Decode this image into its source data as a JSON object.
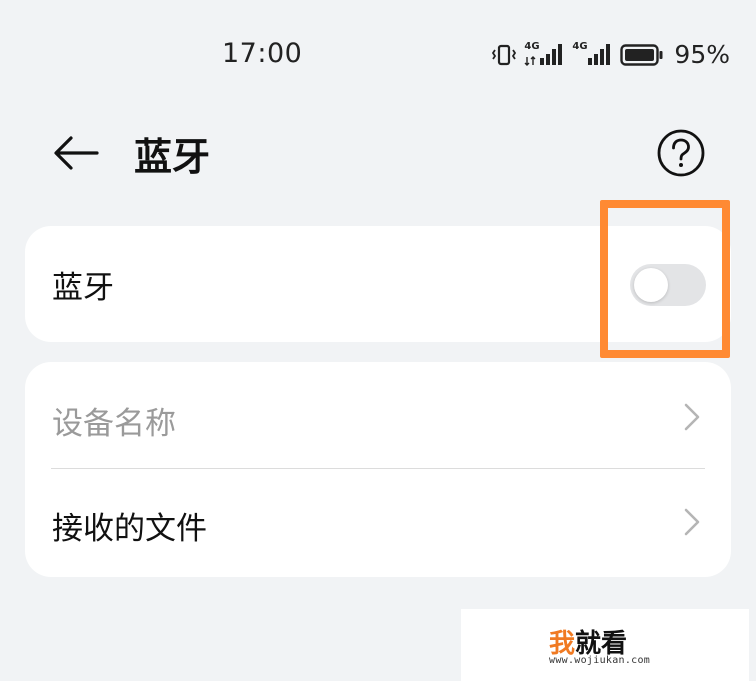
{
  "status_bar": {
    "time": "17:00",
    "battery": "95%",
    "network_1": "4G",
    "network_2": "4G"
  },
  "header": {
    "title": "蓝牙",
    "back_icon": "back-arrow-icon",
    "help_icon": "help-circle-icon"
  },
  "bluetooth": {
    "label": "蓝牙",
    "enabled": false
  },
  "list": {
    "items": [
      {
        "label": "设备名称",
        "disabled": true
      },
      {
        "label": "接收的文件",
        "disabled": false
      }
    ]
  },
  "highlight_color": "#ff8a33",
  "watermark": {
    "first_char": "我",
    "rest": "就看",
    "url": "www.wojiukan.com"
  }
}
